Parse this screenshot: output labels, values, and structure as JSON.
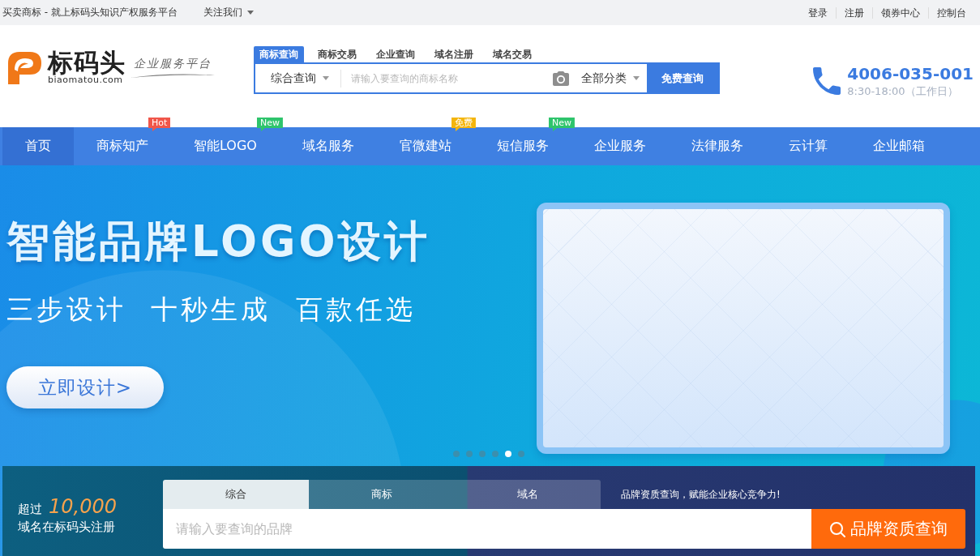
{
  "top_bar": {
    "tagline": "买卖商标 - 就上标码头知识产权服务平台",
    "follow_menu": "关注我们",
    "links": [
      "登录",
      "注册",
      "领券中心",
      "控制台"
    ]
  },
  "header": {
    "logo": {
      "name": "标码头",
      "domain": "biaomatou.com",
      "slogan": "企业服务平台"
    },
    "search": {
      "tabs": [
        {
          "label": "商标查询",
          "selected": true
        },
        {
          "label": "商标交易",
          "selected": false
        },
        {
          "label": "企业查询",
          "selected": false
        },
        {
          "label": "域名注册",
          "selected": false
        },
        {
          "label": "域名交易",
          "selected": false
        }
      ],
      "scope": "综合查询",
      "placeholder": "请输入要查询的商标名称",
      "category": "全部分类",
      "button": "免费查询"
    },
    "hotline": {
      "number": "4006-035-001",
      "hours": "8:30-18:00（工作日）"
    }
  },
  "nav": {
    "items": [
      {
        "label": "首页",
        "selected": true
      },
      {
        "label": "商标知产",
        "selected": false,
        "badge": {
          "text": "Hot",
          "color": "#f0564a"
        }
      },
      {
        "label": "智能LOGO",
        "selected": false,
        "badge": {
          "text": "New",
          "color": "#2ec46c"
        }
      },
      {
        "label": "域名服务",
        "selected": false
      },
      {
        "label": "官微建站",
        "selected": false,
        "badge": {
          "text": "免费",
          "color": "#f4b50c"
        }
      },
      {
        "label": "短信服务",
        "selected": false,
        "badge": {
          "text": "New",
          "color": "#2ec46c"
        }
      },
      {
        "label": "企业服务",
        "selected": false
      },
      {
        "label": "法律服务",
        "selected": false
      },
      {
        "label": "云计算",
        "selected": false
      },
      {
        "label": "企业邮箱",
        "selected": false
      }
    ]
  },
  "banner": {
    "title": "智能品牌LOGO设计",
    "subtitle": "三步设计 十秒生成 百款任选",
    "button": "立即设计>",
    "dots": [
      {
        "selected": false
      },
      {
        "selected": false
      },
      {
        "selected": false
      },
      {
        "selected": false
      },
      {
        "selected": true
      },
      {
        "selected": false
      }
    ]
  },
  "brand_search": {
    "stat_prefix": "超过",
    "stat_number": "10,000",
    "stat_caption": "域名在标码头注册",
    "tabs": [
      {
        "label": "综合",
        "selected": true
      },
      {
        "label": "商标",
        "selected": false
      },
      {
        "label": "域名",
        "selected": false
      }
    ],
    "slogan": "品牌资质查询，赋能企业核心竞争力!",
    "placeholder": "请输入要查询的品牌",
    "button": "品牌资质查询"
  }
}
